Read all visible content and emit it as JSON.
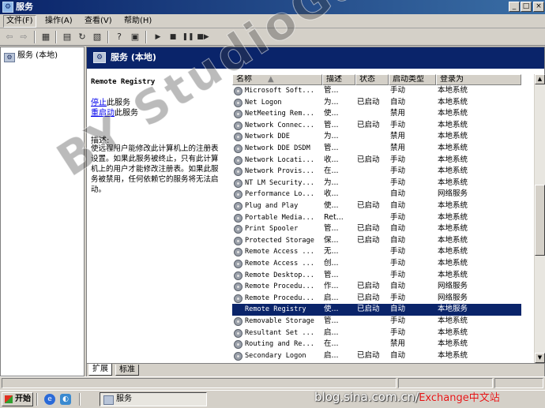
{
  "window": {
    "title": "服务",
    "controls": [
      "_",
      "□",
      "×"
    ]
  },
  "menubar": [
    {
      "label": "文件(F)"
    },
    {
      "label": "操作(A)"
    },
    {
      "label": "查看(V)"
    },
    {
      "label": "帮助(H)"
    }
  ],
  "toolbar": {
    "icons": [
      "back-icon",
      "forward-icon",
      "show-tree-icon",
      "properties-icon",
      "refresh-icon",
      "export-list-icon",
      "help-icon",
      "console-icon",
      "start-service-icon",
      "stop-service-icon",
      "pause-service-icon",
      "restart-service-icon"
    ]
  },
  "tree": {
    "root_label": "服务 (本地)"
  },
  "detail": {
    "header_title": "服务 (本地)",
    "selected_service": "Remote Registry",
    "actions": [
      {
        "link": "停止",
        "suffix": "此服务"
      },
      {
        "link": "重启动",
        "suffix": "此服务"
      }
    ],
    "desc_label": "描述:",
    "description": "使远程用户能修改此计算机上的注册表设置。如果此服务被终止，只有此计算机上的用户才能修改注册表。如果此服务被禁用，任何依赖它的服务将无法启动。",
    "columns": [
      "名称",
      "描述",
      "状态",
      "启动类型",
      "登录为"
    ],
    "services": [
      {
        "name": "Microsoft Soft...",
        "desc": "管...",
        "status": "",
        "startup": "手动",
        "logon": "本地系统"
      },
      {
        "name": "Net Logon",
        "desc": "为...",
        "status": "已启动",
        "startup": "自动",
        "logon": "本地系统"
      },
      {
        "name": "NetMeeting Rem...",
        "desc": "使...",
        "status": "",
        "startup": "禁用",
        "logon": "本地系统"
      },
      {
        "name": "Network Connec...",
        "desc": "管...",
        "status": "已启动",
        "startup": "手动",
        "logon": "本地系统"
      },
      {
        "name": "Network DDE",
        "desc": "为...",
        "status": "",
        "startup": "禁用",
        "logon": "本地系统"
      },
      {
        "name": "Network DDE DSDM",
        "desc": "管...",
        "status": "",
        "startup": "禁用",
        "logon": "本地系统"
      },
      {
        "name": "Network Locati...",
        "desc": "收...",
        "status": "已启动",
        "startup": "手动",
        "logon": "本地系统"
      },
      {
        "name": "Network Provis...",
        "desc": "在...",
        "status": "",
        "startup": "手动",
        "logon": "本地系统"
      },
      {
        "name": "NT LM Security...",
        "desc": "为...",
        "status": "",
        "startup": "手动",
        "logon": "本地系统"
      },
      {
        "name": "Performance Lo...",
        "desc": "收...",
        "status": "",
        "startup": "自动",
        "logon": "网络服务"
      },
      {
        "name": "Plug and Play",
        "desc": "使...",
        "status": "已启动",
        "startup": "自动",
        "logon": "本地系统"
      },
      {
        "name": "Portable Media...",
        "desc": "Ret...",
        "status": "",
        "startup": "手动",
        "logon": "本地系统"
      },
      {
        "name": "Print Spooler",
        "desc": "管...",
        "status": "已启动",
        "startup": "自动",
        "logon": "本地系统"
      },
      {
        "name": "Protected Storage",
        "desc": "保...",
        "status": "已启动",
        "startup": "自动",
        "logon": "本地系统"
      },
      {
        "name": "Remote Access ...",
        "desc": "无...",
        "status": "",
        "startup": "手动",
        "logon": "本地系统"
      },
      {
        "name": "Remote Access ...",
        "desc": "创...",
        "status": "",
        "startup": "手动",
        "logon": "本地系统"
      },
      {
        "name": "Remote Desktop...",
        "desc": "管...",
        "status": "",
        "startup": "手动",
        "logon": "本地系统"
      },
      {
        "name": "Remote Procedu...",
        "desc": "作...",
        "status": "已启动",
        "startup": "自动",
        "logon": "网络服务"
      },
      {
        "name": "Remote Procedu...",
        "desc": "启...",
        "status": "已启动",
        "startup": "手动",
        "logon": "网络服务"
      },
      {
        "name": "Remote Registry",
        "desc": "使...",
        "status": "已启动",
        "startup": "自动",
        "logon": "本地服务",
        "selected": true
      },
      {
        "name": "Removable Storage",
        "desc": "管...",
        "status": "",
        "startup": "手动",
        "logon": "本地系统"
      },
      {
        "name": "Resultant Set ...",
        "desc": "启...",
        "status": "",
        "startup": "手动",
        "logon": "本地系统"
      },
      {
        "name": "Routing and Re...",
        "desc": "在...",
        "status": "",
        "startup": "禁用",
        "logon": "本地系统"
      },
      {
        "name": "Secondary Logon",
        "desc": "启...",
        "status": "已启动",
        "startup": "自动",
        "logon": "本地系统"
      }
    ],
    "tabs": [
      {
        "label": "扩展",
        "active": true
      },
      {
        "label": "标准",
        "active": false
      }
    ]
  },
  "taskbar": {
    "start_label": "开始",
    "task_label": "服务"
  },
  "overlays": {
    "watermark": "BY StudioGang",
    "blog_text": "blog.sina.com.cn/",
    "blog_red": "Exchange中文站"
  }
}
